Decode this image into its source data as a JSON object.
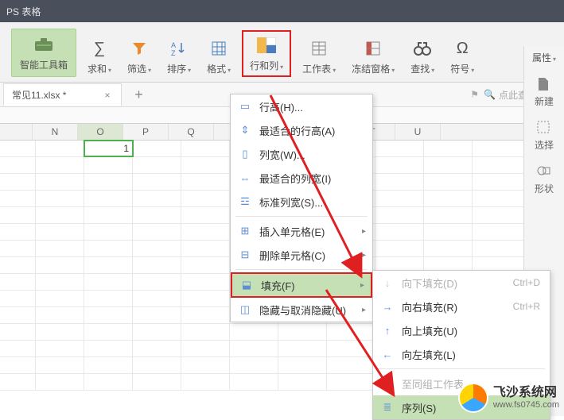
{
  "titlebar": {
    "product": "PS 表格"
  },
  "ribbon": {
    "toolbox": "智能工具箱",
    "sum": "求和",
    "filter": "筛选",
    "sort": "排序",
    "format": "格式",
    "rowcol": "行和列",
    "worksheet": "工作表",
    "freeze": "冻结窗格",
    "find": "查找",
    "symbol": "符号"
  },
  "tabs": {
    "file": "常见11.xlsx *",
    "search_placeholder": "点此查找命令"
  },
  "propbar": {
    "title": "属性",
    "new": "新建",
    "select": "选择",
    "shape": "形状"
  },
  "columns": [
    "N",
    "O",
    "P",
    "Q",
    "",
    "",
    "",
    "T",
    "U"
  ],
  "selected_cell_value": "1",
  "menu": {
    "row_height": "行高(H)...",
    "autofit_row": "最适合的行高(A)",
    "col_width": "列宽(W)...",
    "autofit_col": "最适合的列宽(I)",
    "std_col_width": "标准列宽(S)...",
    "insert_cells": "插入单元格(E)",
    "delete_cells": "删除单元格(C)",
    "fill": "填充(F)",
    "hide_unhide": "隐藏与取消隐藏(U)"
  },
  "submenu": {
    "fill_down": "向下填充(D)",
    "fill_down_sc": "Ctrl+D",
    "fill_right": "向右填充(R)",
    "fill_right_sc": "Ctrl+R",
    "fill_up": "向上填充(U)",
    "fill_left": "向左填充(L)",
    "to_group": "至同组工作表...",
    "series": "序列(S)"
  },
  "watermark": {
    "name": "飞沙系统网",
    "url": "www.fs0745.com"
  }
}
